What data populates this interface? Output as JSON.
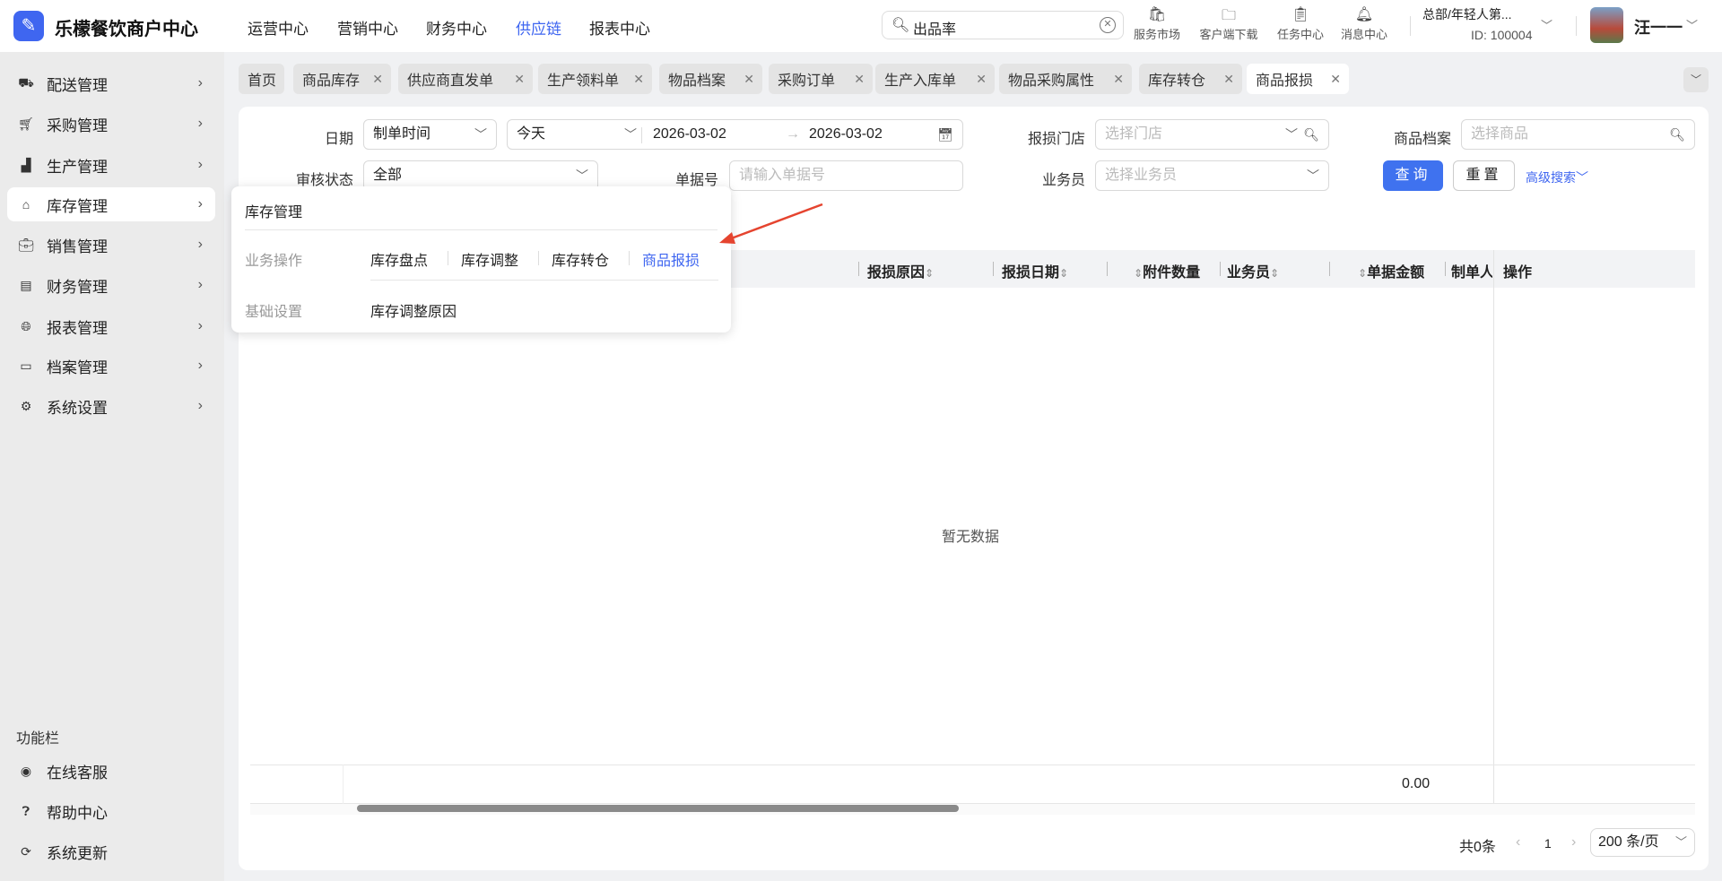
{
  "header": {
    "logo_glyph": "✎",
    "app_title": "乐檬餐饮商户中心",
    "nav": [
      {
        "label": "运营中心"
      },
      {
        "label": "营销中心"
      },
      {
        "label": "财务中心"
      },
      {
        "label": "供应链",
        "active": true
      },
      {
        "label": "报表中心"
      }
    ],
    "search_value": "出品率",
    "tools": [
      {
        "label": "服务市场",
        "icon": "shop-bag-icon"
      },
      {
        "label": "客户端下载",
        "icon": "download-folder-icon"
      },
      {
        "label": "任务中心",
        "icon": "clipboard-check-icon"
      },
      {
        "label": "消息中心",
        "icon": "bell-icon"
      }
    ],
    "org": "总部/年轻人第...",
    "org_id": "ID: 100004",
    "user": "汪一一"
  },
  "sidebar": {
    "items": [
      {
        "label": "配送管理",
        "icon": "truck-icon"
      },
      {
        "label": "采购管理",
        "icon": "cart-icon"
      },
      {
        "label": "生产管理",
        "icon": "factory-icon"
      },
      {
        "label": "库存管理",
        "icon": "warehouse-icon"
      },
      {
        "label": "销售管理",
        "icon": "briefcase-icon"
      },
      {
        "label": "财务管理",
        "icon": "ledger-icon"
      },
      {
        "label": "报表管理",
        "icon": "globe-icon"
      },
      {
        "label": "档案管理",
        "icon": "inbox-icon"
      },
      {
        "label": "系统设置",
        "icon": "gear-icon"
      }
    ],
    "function_title": "功能栏",
    "functions": [
      {
        "label": "在线客服"
      },
      {
        "label": "帮助中心"
      },
      {
        "label": "系统更新"
      }
    ]
  },
  "tabs": [
    {
      "label": "首页"
    },
    {
      "label": "商品库存"
    },
    {
      "label": "供应商直发单"
    },
    {
      "label": "生产领料单"
    },
    {
      "label": "物品档案"
    },
    {
      "label": "采购订单"
    },
    {
      "label": "生产入库单"
    },
    {
      "label": "物品采购属性"
    },
    {
      "label": "库存转仓"
    },
    {
      "label": "商品报损",
      "active": true
    }
  ],
  "filters": {
    "date_label": "日期",
    "date_type": "制单时间",
    "date_range_preset": "今天",
    "date_start": "2026-03-02",
    "date_end": "2026-03-02",
    "store_label": "报损门店",
    "store_placeholder": "选择门店",
    "product_label": "商品档案",
    "product_placeholder": "选择商品",
    "audit_label": "审核状态",
    "audit_value": "全部",
    "doc_no_label": "单据号",
    "doc_no_placeholder": "请输入单据号",
    "salesman_label": "业务员",
    "salesman_placeholder": "选择业务员",
    "query": "查询",
    "reset": "重置",
    "advanced": "高级搜索"
  },
  "table": {
    "columns": [
      "报损原因",
      "报损日期",
      "附件数量",
      "业务员",
      "单据金额",
      "制单人",
      "操作"
    ],
    "empty_text": "暂无数据",
    "sum_amount": "0.00"
  },
  "pagination": {
    "total": "共0条",
    "page": "1",
    "page_size": "200 条/页"
  },
  "popup": {
    "title": "库存管理",
    "groups": [
      {
        "label": "业务操作",
        "links": [
          "库存盘点",
          "库存调整",
          "库存转仓",
          "商品报损"
        ]
      },
      {
        "label": "基础设置",
        "links": [
          "库存调整原因"
        ]
      }
    ]
  },
  "colors": {
    "accent": "#3f66f0",
    "annotation_arrow": "#e5442f"
  }
}
